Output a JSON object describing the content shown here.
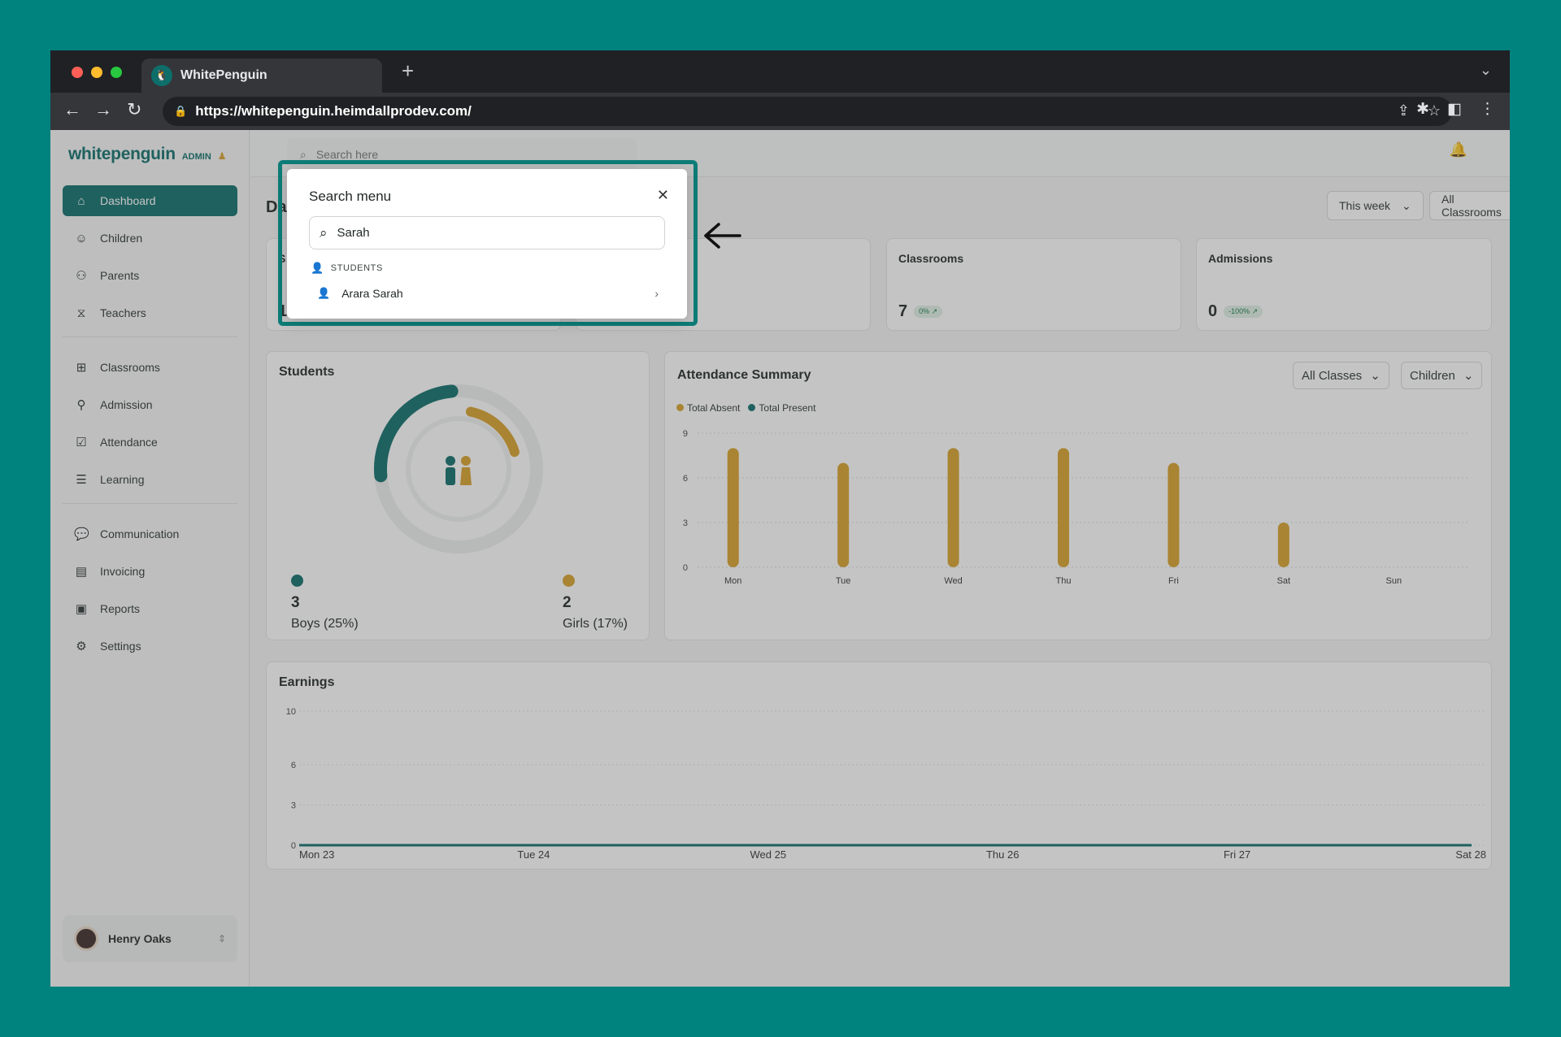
{
  "browser": {
    "tab_title": "WhitePenguin",
    "url": "https://whitepenguin.heimdallprodev.com/",
    "traffic_colors": [
      "#ff5f57",
      "#febc2e",
      "#28c840"
    ]
  },
  "sidebar": {
    "logo": "whitepenguin",
    "badge": "ADMIN",
    "items": [
      {
        "label": "Dashboard",
        "icon": "house-icon"
      },
      {
        "label": "Children",
        "icon": "child-icon"
      },
      {
        "label": "Parents",
        "icon": "users-icon"
      },
      {
        "label": "Teachers",
        "icon": "teacher-icon"
      },
      {
        "label": "Classrooms",
        "icon": "grid-icon"
      },
      {
        "label": "Admission",
        "icon": "user-plus-icon"
      },
      {
        "label": "Attendance",
        "icon": "checkbox-icon"
      },
      {
        "label": "Learning",
        "icon": "book-icon"
      },
      {
        "label": "Communication",
        "icon": "chat-icon"
      },
      {
        "label": "Invoicing",
        "icon": "invoice-icon"
      },
      {
        "label": "Reports",
        "icon": "report-icon"
      },
      {
        "label": "Settings",
        "icon": "gear-icon"
      }
    ],
    "user": {
      "name": "Henry Oaks"
    }
  },
  "topbar": {
    "search_placeholder": "Search here"
  },
  "page": {
    "title": "Da",
    "filters": {
      "period": "This week",
      "classroom": "All Classrooms"
    }
  },
  "stats": [
    {
      "title": "Classrooms",
      "value": "7",
      "change": "0% ↗"
    },
    {
      "title": "Admissions",
      "value": "0",
      "change": "-100% ↗"
    }
  ],
  "partial_stats": {
    "first_label": "S",
    "first_value": "1."
  },
  "students": {
    "title": "Students",
    "boys": {
      "count": "3",
      "label": "Boys (25%)"
    },
    "girls": {
      "count": "2",
      "label": "Girls (17%)"
    }
  },
  "attendance": {
    "title": "Attendance Summary",
    "class_filter": "All Classes",
    "type_filter": "Children"
  },
  "earnings": {
    "title": "Earnings"
  },
  "colors": {
    "brand": "#0d6e6a",
    "accent": "#d8a12a"
  },
  "chart_data": [
    {
      "type": "donut",
      "series": [
        {
          "name": "Boys (25%)",
          "values": [
            25
          ]
        },
        {
          "name": "Girls (17%)",
          "values": [
            17
          ]
        }
      ],
      "categories": [
        "Boys (25%)",
        "Girls (17%)"
      ]
    },
    {
      "type": "bar",
      "title": "Attendance Summary",
      "categories": [
        "Mon",
        "Tue",
        "Wed",
        "Thu",
        "Fri",
        "Sat",
        "Sun"
      ],
      "series": [
        {
          "name": "Total Absent",
          "values": [
            8,
            7,
            8,
            8,
            7,
            3,
            0
          ]
        },
        {
          "name": "Total Present",
          "values": [
            0,
            0,
            0,
            0,
            0,
            0,
            0
          ]
        }
      ],
      "yticks": [
        0,
        3,
        6,
        9
      ],
      "ylim": [
        0,
        9
      ],
      "legend": "top-left"
    },
    {
      "type": "line",
      "title": "Earnings",
      "categories": [
        "Mon 23",
        "Tue 24",
        "Wed 25",
        "Thu 26",
        "Fri 27",
        "Sat 28"
      ],
      "values": [
        0,
        0,
        0,
        0,
        0,
        0
      ],
      "yticks": [
        0,
        3,
        6,
        10
      ],
      "ylim": [
        0,
        10
      ]
    }
  ],
  "search_modal": {
    "title": "Search menu",
    "query": "Sarah",
    "group_label": "STUDENTS",
    "results": [
      {
        "label": "Arara Sarah"
      }
    ]
  }
}
